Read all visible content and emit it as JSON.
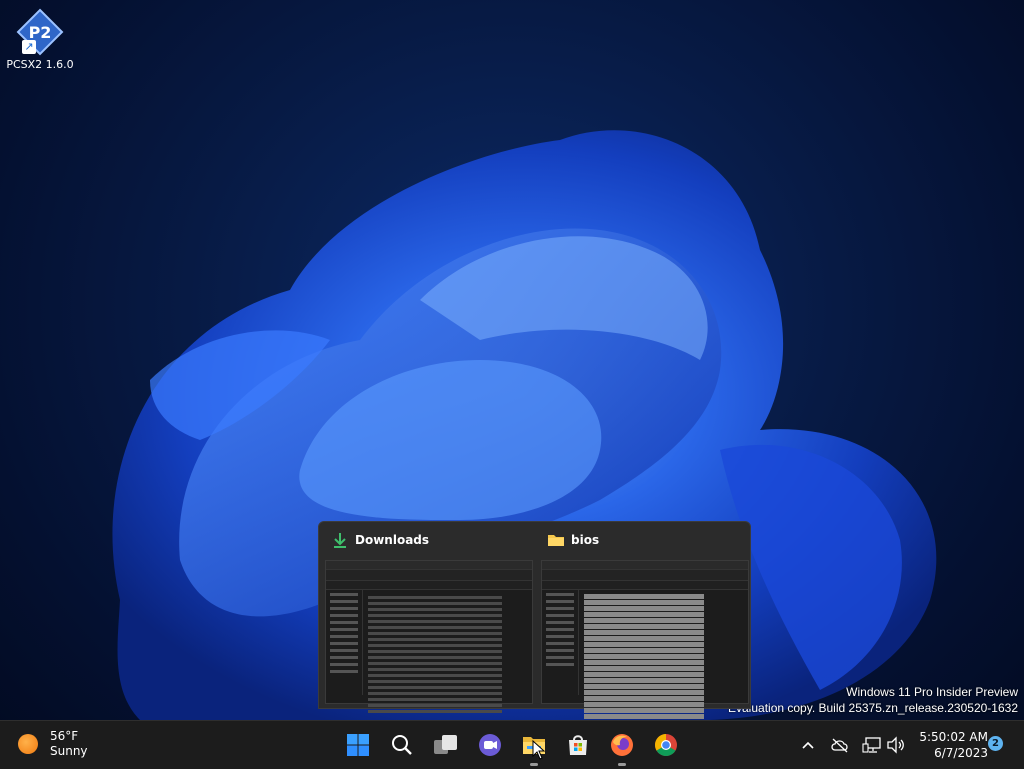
{
  "desktop": {
    "icons": [
      {
        "label": "PCSX2 1.6.0"
      }
    ]
  },
  "watermark": {
    "line1": "Windows 11 Pro Insider Preview",
    "line2": "Evaluation copy. Build 25375.zn_release.230520-1632"
  },
  "preview": {
    "windows": [
      {
        "title": "Downloads",
        "icon": "download-arrow-icon"
      },
      {
        "title": "bios",
        "icon": "folder-icon"
      }
    ]
  },
  "taskbar": {
    "weather": {
      "temp": "56°F",
      "condition": "Sunny"
    },
    "apps": [
      {
        "name": "start",
        "icon": "windows-logo-icon"
      },
      {
        "name": "search",
        "icon": "search-icon"
      },
      {
        "name": "task-view",
        "icon": "task-view-icon"
      },
      {
        "name": "teams-chat",
        "icon": "chat-icon"
      },
      {
        "name": "file-explorer",
        "icon": "folder-icon"
      },
      {
        "name": "microsoft-store",
        "icon": "store-icon"
      },
      {
        "name": "firefox",
        "icon": "firefox-icon"
      },
      {
        "name": "chrome",
        "icon": "chrome-icon"
      }
    ],
    "tray": {
      "time": "5:50:02 AM",
      "date": "6/7/2023",
      "notification_count": "2"
    }
  },
  "colors": {
    "accent": "#1a6bd6",
    "taskbar": "#1c1c1c",
    "folder": "#f5c84c",
    "download": "#3fbf6c"
  }
}
